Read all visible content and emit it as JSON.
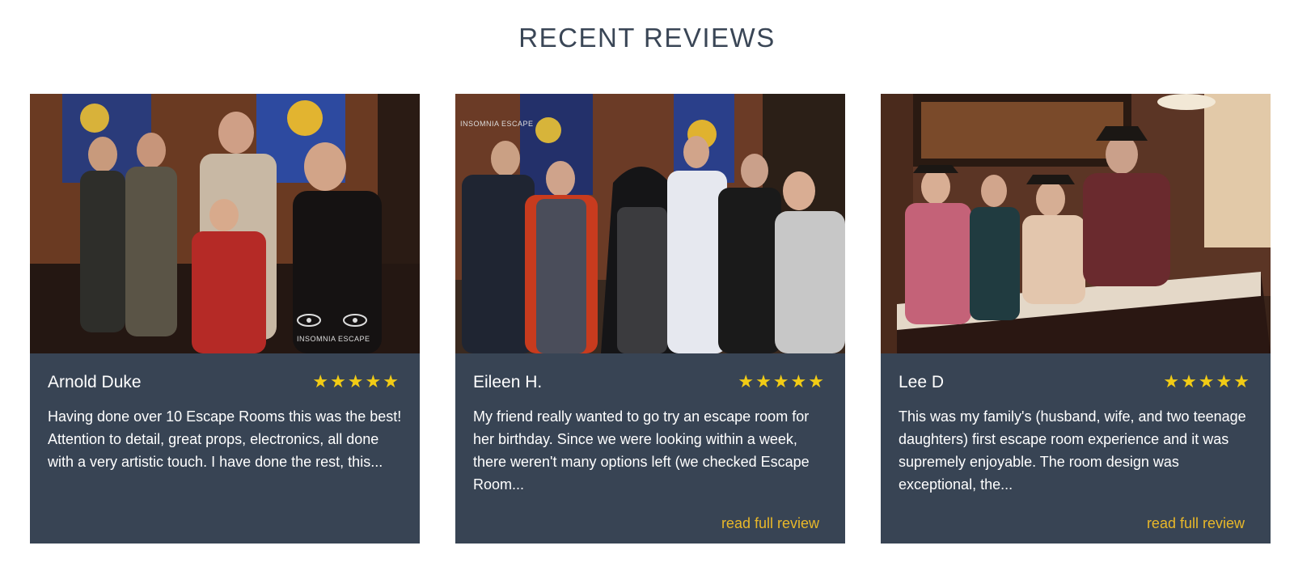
{
  "section": {
    "title": "RECENT REVIEWS"
  },
  "colors": {
    "card_background": "#384454",
    "star": "#f2cc15",
    "link": "#e9b829",
    "title": "#3a4656"
  },
  "reviews": [
    {
      "name": "Arnold Duke",
      "rating": 5,
      "text": "Having done over 10 Escape Rooms this was the best! Attention to detail, great props, electronics, all done with a very artistic touch. I have done the rest, this...",
      "watermark": "INSOMNIA ESCAPE",
      "link": ""
    },
    {
      "name": "Eileen H.",
      "rating": 5,
      "text": "My friend really wanted to go try an escape room for her birthday. Since we were looking within a week, there weren't many options left (we checked Escape Room...",
      "watermark": "INSOMNIA ESCAPE",
      "link": "read full review"
    },
    {
      "name": "Lee D",
      "rating": 5,
      "text": "This was my family's (husband, wife, and two teenage daughters) first escape room experience and it was supremely enjoyable. The room design was exceptional, the...",
      "watermark": "",
      "link": "read full review"
    }
  ]
}
